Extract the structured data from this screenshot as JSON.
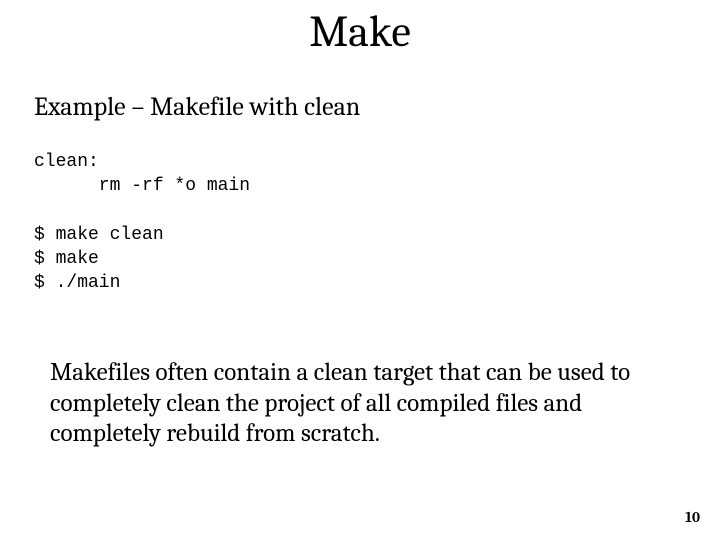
{
  "slide": {
    "title": "Make",
    "subtitle": "Example – Makefile with clean",
    "code": "clean:\n      rm -rf *o main\n\n$ make clean\n$ make\n$ ./main",
    "body": "Makefiles often contain a clean target that can be used to completely clean the project of all compiled files and completely rebuild from scratch.",
    "page_number": "10"
  }
}
